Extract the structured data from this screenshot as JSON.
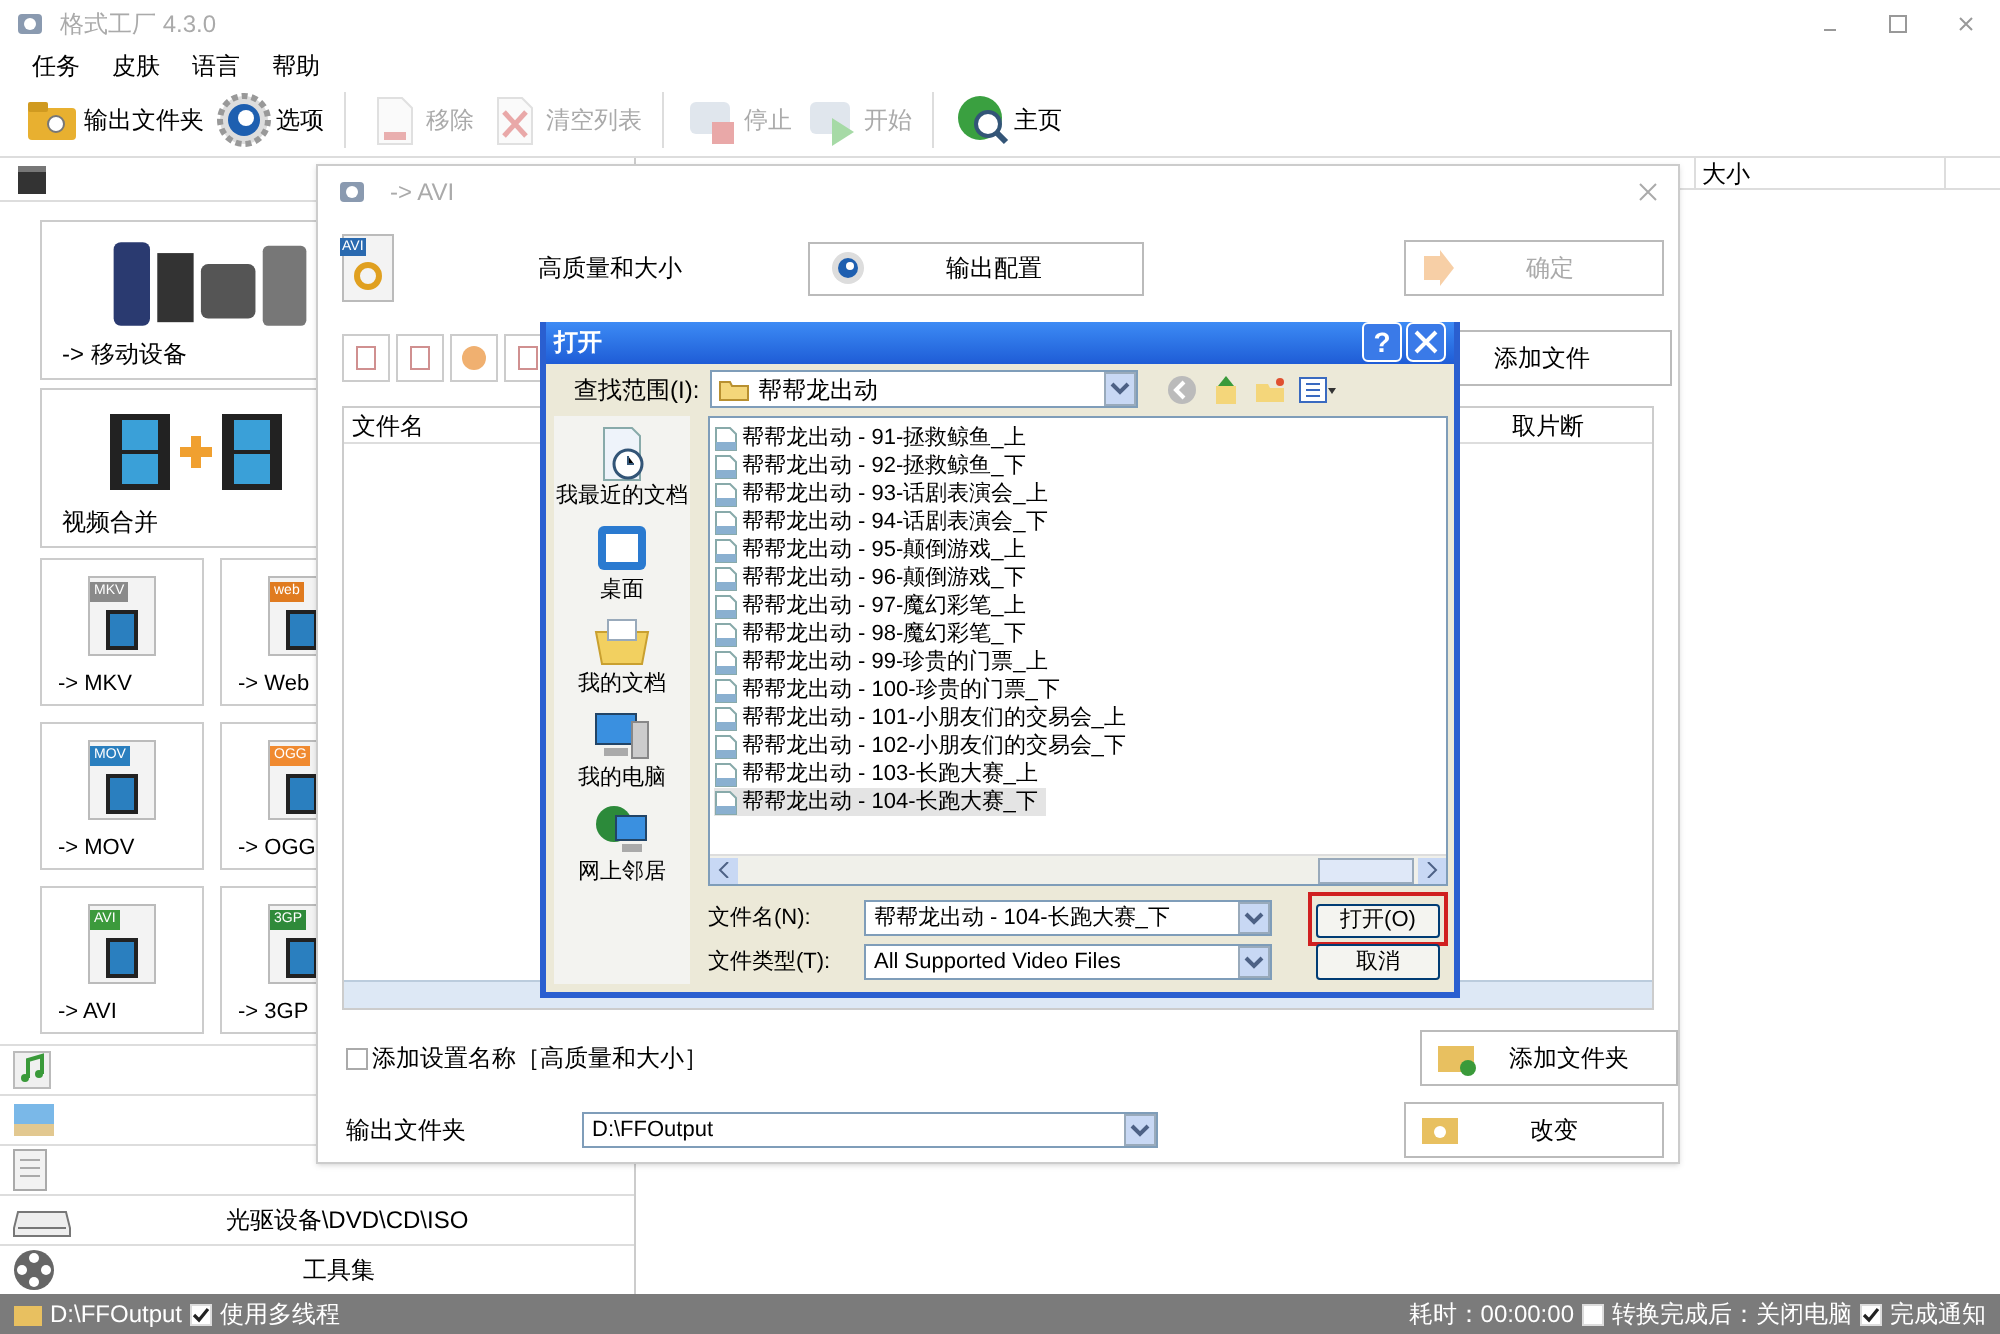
{
  "window": {
    "title": "格式工厂 4.3.0"
  },
  "menu": [
    "任务",
    "皮肤",
    "语言",
    "帮助"
  ],
  "toolbar": [
    {
      "label": "输出文件夹",
      "kind": "folder",
      "disabled": false
    },
    {
      "label": "选项",
      "kind": "gear",
      "disabled": false
    },
    {
      "label": "移除",
      "kind": "remove",
      "disabled": true
    },
    {
      "label": "清空列表",
      "kind": "clear",
      "disabled": true
    },
    {
      "label": "停止",
      "kind": "stop",
      "disabled": true
    },
    {
      "label": "开始",
      "kind": "start",
      "disabled": true
    },
    {
      "label": "主页",
      "kind": "globe",
      "disabled": false
    }
  ],
  "sidebar": {
    "large_tiles": [
      {
        "label": "-> 移动设备",
        "kind": "devices"
      },
      {
        "label": "视频合并",
        "kind": "merge"
      }
    ],
    "tiles": [
      {
        "label": "-> MKV",
        "badge": "MKV",
        "color": "#8a8a8a"
      },
      {
        "label": "-> Web",
        "badge": "web",
        "color": "#e07b20"
      },
      {
        "label": "-> MOV",
        "badge": "MOV",
        "color": "#2a7fbf"
      },
      {
        "label": "-> OGG",
        "badge": "OGG",
        "color": "#f08a30"
      },
      {
        "label": "-> AVI",
        "badge": "AVI",
        "color": "#3c9a3c"
      },
      {
        "label": "-> 3GP",
        "badge": "3GP",
        "color": "#2f8a3a"
      }
    ],
    "categories": [
      {
        "kind": "music"
      },
      {
        "kind": "picture"
      },
      {
        "kind": "document"
      },
      {
        "kind": "disc",
        "label": "光驱设备\\DVD\\CD\\ISO"
      },
      {
        "kind": "tools",
        "label": "工具集"
      }
    ]
  },
  "main_list": {
    "columns": [
      "大小"
    ]
  },
  "avi_dialog": {
    "title": "-> AVI",
    "badge": "AVI",
    "quality": "高质量和大小",
    "config_button": "输出配置",
    "ok_button": {
      "label": "确定",
      "disabled": true
    },
    "add_file_button": "添加文件",
    "table": {
      "columns": [
        "文件名",
        "取片断"
      ]
    },
    "add_setting_name": {
      "label": "添加设置名称［高质量和大小］",
      "checked": false
    },
    "add_folder_button": "添加文件夹",
    "output_folder": {
      "label": "输出文件夹",
      "value": "D:\\FFOutput"
    },
    "change_button": "改变"
  },
  "open_dialog": {
    "title": "打开",
    "help": "?",
    "look_in": {
      "label": "查找范围(I):",
      "value": "帮帮龙出动"
    },
    "places": [
      {
        "label": "我最近的文档",
        "kind": "recent"
      },
      {
        "label": "桌面",
        "kind": "desktop"
      },
      {
        "label": "我的文档",
        "kind": "documents"
      },
      {
        "label": "我的电脑",
        "kind": "computer"
      },
      {
        "label": "网上邻居",
        "kind": "network"
      }
    ],
    "files": [
      {
        "name": "帮帮龙出动 - 91-拯救鲸鱼_上",
        "selected": false
      },
      {
        "name": "帮帮龙出动 - 92-拯救鲸鱼_下",
        "selected": false
      },
      {
        "name": "帮帮龙出动 - 93-话剧表演会_上",
        "selected": false
      },
      {
        "name": "帮帮龙出动 - 94-话剧表演会_下",
        "selected": false
      },
      {
        "name": "帮帮龙出动 - 95-颠倒游戏_上",
        "selected": false
      },
      {
        "name": "帮帮龙出动 - 96-颠倒游戏_下",
        "selected": false
      },
      {
        "name": "帮帮龙出动 - 97-魔幻彩笔_上",
        "selected": false
      },
      {
        "name": "帮帮龙出动 - 98-魔幻彩笔_下",
        "selected": false
      },
      {
        "name": "帮帮龙出动 - 99-珍贵的门票_上",
        "selected": false
      },
      {
        "name": "帮帮龙出动 - 100-珍贵的门票_下",
        "selected": false
      },
      {
        "name": "帮帮龙出动 - 101-小朋友们的交易会_上",
        "selected": false
      },
      {
        "name": "帮帮龙出动 - 102-小朋友们的交易会_下",
        "selected": false
      },
      {
        "name": "帮帮龙出动 - 103-长跑大赛_上",
        "selected": false
      },
      {
        "name": "帮帮龙出动 - 104-长跑大赛_下",
        "selected": true
      }
    ],
    "file_name": {
      "label": "文件名(N):",
      "value": "帮帮龙出动 - 104-长跑大赛_下"
    },
    "file_type": {
      "label": "文件类型(T):",
      "value": "All Supported Video Files"
    },
    "open_button": {
      "label": "打开(O)",
      "highlighted": true
    },
    "cancel_button": "取消"
  },
  "status_bar": {
    "output_path": "D:\\FFOutput",
    "multithread": {
      "label": "使用多线程",
      "checked": true
    },
    "elapsed": "耗时：00:00:00",
    "shutdown": {
      "label": "转换完成后：关闭电脑",
      "checked": false
    },
    "notify": {
      "label": "完成通知",
      "checked": true
    }
  }
}
